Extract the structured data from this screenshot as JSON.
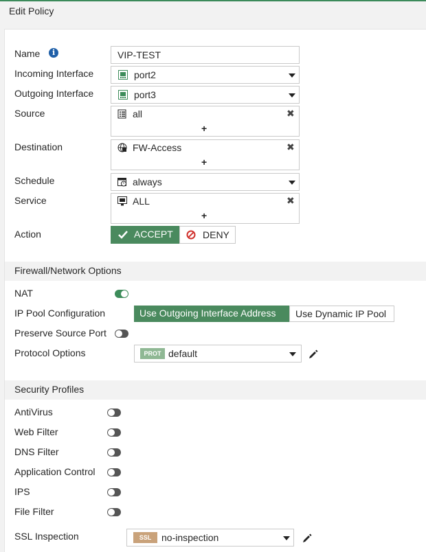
{
  "window": {
    "title": "Edit Policy"
  },
  "fields": {
    "name": {
      "label": "Name",
      "value": "VIP-TEST"
    },
    "incoming": {
      "label": "Incoming Interface",
      "value": "port2"
    },
    "outgoing": {
      "label": "Outgoing Interface",
      "value": "port3"
    },
    "source": {
      "label": "Source",
      "value": "all",
      "add": "+"
    },
    "destination": {
      "label": "Destination",
      "value": "FW-Access",
      "add": "+"
    },
    "schedule": {
      "label": "Schedule",
      "value": "always"
    },
    "service": {
      "label": "Service",
      "value": "ALL",
      "add": "+"
    },
    "action": {
      "label": "Action",
      "accept": "ACCEPT",
      "deny": "DENY",
      "selected": "ACCEPT"
    }
  },
  "firewall": {
    "title": "Firewall/Network Options",
    "nat": {
      "label": "NAT",
      "enabled": true
    },
    "ip_pool": {
      "label": "IP Pool Configuration",
      "option_outgoing": "Use Outgoing Interface Address",
      "option_dynamic": "Use Dynamic IP Pool",
      "selected": "Use Outgoing Interface Address"
    },
    "preserve_port": {
      "label": "Preserve Source Port",
      "enabled": false
    },
    "protocol": {
      "label": "Protocol Options",
      "badge": "PROT",
      "value": "default"
    }
  },
  "security": {
    "title": "Security Profiles",
    "antivirus": {
      "label": "AntiVirus",
      "enabled": false
    },
    "web_filter": {
      "label": "Web Filter",
      "enabled": false
    },
    "dns_filter": {
      "label": "DNS Filter",
      "enabled": false
    },
    "app_control": {
      "label": "Application Control",
      "enabled": false
    },
    "ips": {
      "label": "IPS",
      "enabled": false
    },
    "file_filter": {
      "label": "File Filter",
      "enabled": false
    },
    "ssl": {
      "label": "SSL Inspection",
      "badge": "SSL",
      "value": "no-inspection"
    }
  },
  "colors": {
    "accent_green": "#4a8a5e",
    "deny_red": "#d0312d",
    "prot_badge": "#8fb894",
    "ssl_badge": "#c9a27a"
  }
}
